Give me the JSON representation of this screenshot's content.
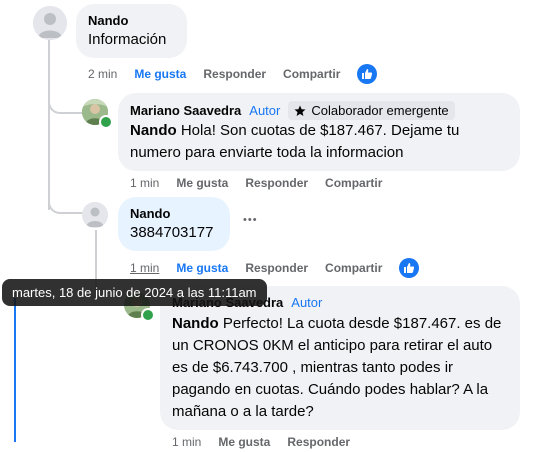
{
  "comments": [
    {
      "author": "Nando",
      "text": "Información",
      "time": "2 min",
      "like": "Me gusta",
      "reply": "Responder",
      "share": "Compartir"
    },
    {
      "author": "Mariano Saavedra",
      "author_tag": "Autor",
      "badge": "Colaborador emergente",
      "mention": "Nando",
      "text": " Hola! Son cuotas de $187.467. Dejame tu numero para enviarte toda la informacion",
      "time": "1 min",
      "like": "Me gusta",
      "reply": "Responder",
      "share": "Compartir"
    },
    {
      "author": "Nando",
      "text": "3884703177",
      "time": "1 min",
      "like": "Me gusta",
      "reply": "Responder",
      "share": "Compartir"
    },
    {
      "author": "Mariano Saavedra",
      "author_tag": "Autor",
      "mention": "Nando",
      "text": " Perfecto! La cuota desde $187.467. es de un CRONOS 0KM el anticipo para retirar el auto es de $6.743.700 , mientras tanto podes ir pagando en cuotas. Cuándo podes hablar? A la mañana o a la tarde?",
      "time": "1 min",
      "like": "Me gusta",
      "reply": "Responder"
    }
  ],
  "tooltip": "martes, 18 de junio de 2024 a las 11:11am",
  "more_label": "•••",
  "colors": {
    "accent": "#1877f2",
    "bubble": "#f0f2f5",
    "muted": "#65676b"
  }
}
